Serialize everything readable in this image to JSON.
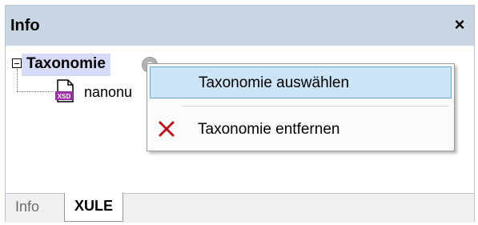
{
  "panel": {
    "title": "Info",
    "close_label": "×"
  },
  "tree": {
    "root_label": "Taxonomie",
    "child_label": "nanonu",
    "child_icon_text": "XSD"
  },
  "context_menu": {
    "items": [
      {
        "label": "Taxonomie auswählen",
        "icon": "none",
        "selected": true
      },
      {
        "label": "Taxonomie entfernen",
        "icon": "x-icon",
        "selected": false
      }
    ]
  },
  "tabs": [
    {
      "label": "Info",
      "active": false
    },
    {
      "label": "XULE",
      "active": true
    }
  ],
  "colors": {
    "titlebar": "#c9d6e3",
    "selection": "#d6dcf7",
    "menu_highlight": "#cce4f7",
    "remove_icon": "#b3101b"
  }
}
